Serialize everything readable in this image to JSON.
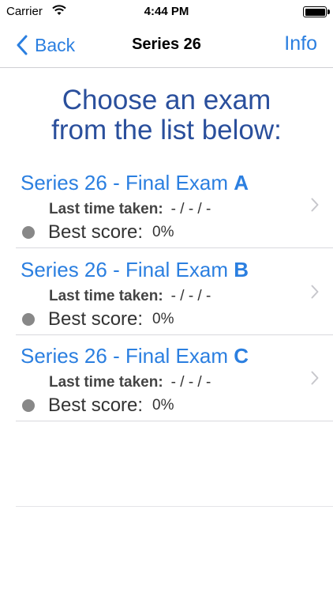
{
  "status_bar": {
    "carrier": "Carrier",
    "time": "4:44 PM",
    "battery_percent": 100
  },
  "nav": {
    "back_label": "Back",
    "title": "Series 26",
    "info_label": "Info"
  },
  "heading": {
    "line1": "Choose an exam",
    "line2": "from the list below:"
  },
  "exams": [
    {
      "title_prefix": "Series 26 - Final Exam ",
      "letter": "A",
      "last_taken_label": "Last time taken:",
      "last_taken_value": "- / - / -",
      "best_score_label": "Best score:",
      "best_score_value": "0%"
    },
    {
      "title_prefix": "Series 26 - Final Exam ",
      "letter": "B",
      "last_taken_label": "Last time taken:",
      "last_taken_value": "- / - / -",
      "best_score_label": "Best score:",
      "best_score_value": "0%"
    },
    {
      "title_prefix": "Series 26 - Final Exam ",
      "letter": "C",
      "last_taken_label": "Last time taken:",
      "last_taken_value": "- / - / -",
      "best_score_label": "Best score:",
      "best_score_value": "0%"
    }
  ],
  "colors": {
    "accent": "#2b7fe0",
    "heading": "#2a4f9c",
    "status_dot": "#888888"
  }
}
